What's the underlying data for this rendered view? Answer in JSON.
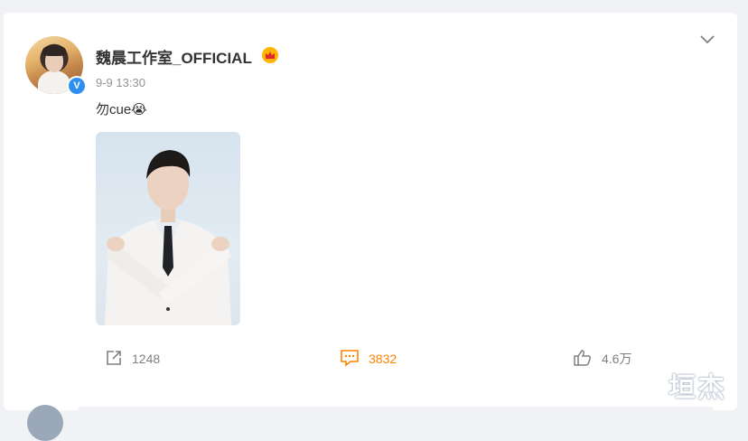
{
  "post": {
    "author_name": "魏晨工作室_OFFICIAL",
    "timestamp": "9-9 13:30",
    "text": "勿cue😭"
  },
  "actions": {
    "repost_count": "1248",
    "comment_count": "3832",
    "like_count": "4.6万"
  },
  "watermark": "垣杰",
  "icons": {
    "collapse": "chevron-down-icon",
    "verified": "verified-icon",
    "member": "member-badge-icon",
    "repost": "repost-icon",
    "comment": "comment-icon",
    "like": "thumbs-up-icon"
  },
  "colors": {
    "accent": "#ff8200",
    "verified": "#2d8ff0",
    "text": "#333333",
    "muted": "#939393"
  }
}
